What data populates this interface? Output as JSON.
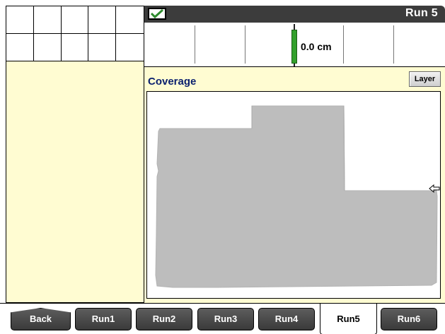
{
  "title_bar": {
    "title": "Run 5",
    "status_icon": "checkmark-icon"
  },
  "guidance": {
    "offset": "0.0 cm"
  },
  "coverage": {
    "title": "Coverage",
    "layer_label": "Layer",
    "cursor_icon": "arrow-left-icon"
  },
  "tabs": [
    {
      "label": "Back",
      "active": false
    },
    {
      "label": "Run1",
      "active": false
    },
    {
      "label": "Run2",
      "active": false
    },
    {
      "label": "Run3",
      "active": false
    },
    {
      "label": "Run4",
      "active": false
    },
    {
      "label": "Run5",
      "active": true
    },
    {
      "label": "Run6",
      "active": false
    }
  ],
  "colors": {
    "panel_yellow": "#fffcd2",
    "coverage_gray": "#bdbdbd",
    "marker_green": "#33a02c",
    "title_bar": "#3c3c3c"
  }
}
